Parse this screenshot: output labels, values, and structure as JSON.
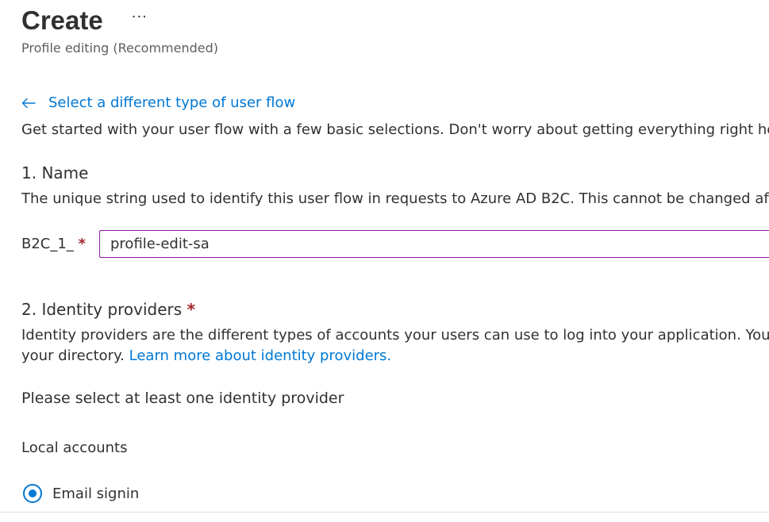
{
  "header": {
    "title": "Create",
    "more_label": "···",
    "subtitle": "Profile editing (Recommended)"
  },
  "back_link": {
    "label": "Select a different type of user flow",
    "icon": "arrow-left-icon"
  },
  "intro": {
    "text": "Get started with your user flow with a few basic selections. Don't worry about getting everything right here, yo"
  },
  "name_section": {
    "title": "1. Name",
    "description": "The unique string used to identify this user flow in requests to Azure AD B2C. This cannot be changed after a u",
    "prefix_label": "B2C_1_",
    "required_mark": "*",
    "input_value": "profile-edit-sa"
  },
  "identity_section": {
    "title": "2. Identity providers",
    "required_mark": "*",
    "description_line1": "Identity providers are the different types of accounts your users can use to log into your application. You need",
    "description_line2": "your directory.",
    "learn_more_link": "Learn more about identity providers.",
    "hint": "Please select at least one identity provider",
    "local_accounts_label": "Local accounts",
    "options": [
      {
        "label": "Email signin",
        "selected": true
      }
    ]
  },
  "colors": {
    "accent": "#0078d4",
    "required": "#a4262c",
    "input_border": "#8a1b9f"
  }
}
